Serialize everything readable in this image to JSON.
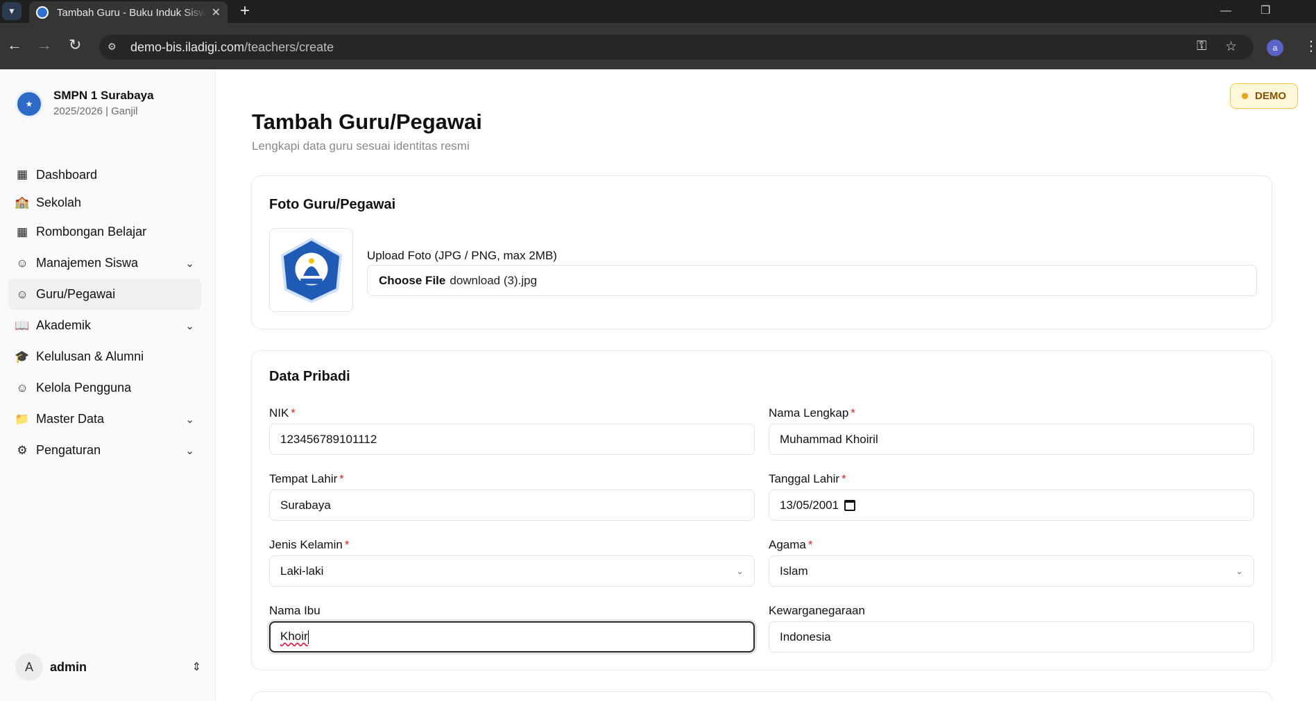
{
  "browser": {
    "tab_title": "Tambah Guru - Buku Induk Siswa",
    "url_host": "demo-bis.iladigi.com",
    "url_path": "/teachers/create",
    "profile_initial": "a"
  },
  "sidebar": {
    "school_name": "SMPN 1 Surabaya",
    "school_year": "2025/2026 | Ganjil",
    "items": [
      {
        "label": "Dashboard",
        "icon": "grid-icon",
        "expandable": false,
        "active": false
      },
      {
        "label": "Sekolah",
        "icon": "school-icon",
        "expandable": false,
        "active": false
      },
      {
        "label": "Rombongan Belajar",
        "icon": "grid-icon",
        "expandable": false,
        "active": false
      },
      {
        "label": "Manajemen Siswa",
        "icon": "user-icon",
        "expandable": true,
        "active": false
      },
      {
        "label": "Guru/Pegawai",
        "icon": "user-icon",
        "expandable": false,
        "active": true
      },
      {
        "label": "Akademik",
        "icon": "book-icon",
        "expandable": true,
        "active": false
      },
      {
        "label": "Kelulusan & Alumni",
        "icon": "graduation-cap-icon",
        "expandable": false,
        "active": false
      },
      {
        "label": "Kelola Pengguna",
        "icon": "user-cog-icon",
        "expandable": false,
        "active": false
      },
      {
        "label": "Master Data",
        "icon": "folder-icon",
        "expandable": true,
        "active": false
      },
      {
        "label": "Pengaturan",
        "icon": "gear-icon",
        "expandable": true,
        "active": false
      }
    ],
    "user": {
      "initial": "A",
      "name": "admin"
    }
  },
  "main": {
    "demo_badge": "DEMO",
    "title": "Tambah Guru/Pegawai",
    "subtitle": "Lengkapi data guru sesuai identitas resmi",
    "photo_section": {
      "title": "Foto Guru/Pegawai",
      "upload_label": "Upload Foto (JPG / PNG, max 2MB)",
      "choose_button": "Choose File",
      "file_name": "download (3).jpg"
    },
    "personal_section": {
      "title": "Data Pribadi",
      "nik": {
        "label": "NIK",
        "value": "123456789101112"
      },
      "nama_lengkap": {
        "label": "Nama Lengkap",
        "value": "Muhammad Khoiril"
      },
      "tempat_lahir": {
        "label": "Tempat Lahir",
        "value": "Surabaya"
      },
      "tanggal_lahir": {
        "label": "Tanggal Lahir",
        "value": "13/05/2001"
      },
      "jenis_kelamin": {
        "label": "Jenis Kelamin",
        "value": "Laki-laki"
      },
      "agama": {
        "label": "Agama",
        "value": "Islam"
      },
      "nama_ibu": {
        "label": "Nama Ibu",
        "value": "Khoir"
      },
      "kewarganegaraan": {
        "label": "Kewarganegaraan",
        "value": "Indonesia"
      },
      "required_mark": "*"
    }
  }
}
